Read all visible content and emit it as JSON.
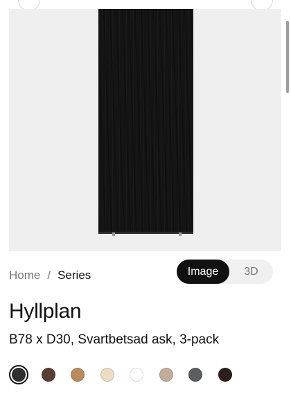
{
  "breadcrumb": {
    "home": "Home",
    "separator": "/",
    "current": "Series"
  },
  "view_toggle": {
    "image_label": "Image",
    "threed_label": "3D",
    "active": "Image"
  },
  "product": {
    "title": "Hyllplan",
    "subtitle": "B78 x D30, Svartbetsad ask, 3-pack"
  },
  "swatches": {
    "selected_index": 0,
    "colors": [
      "#2f3030",
      "#5a3e33",
      "#b98b5e",
      "#ecdcc4",
      "#ffffff",
      "#c2ad9a",
      "#5c5e60",
      "#2a1f1b"
    ]
  },
  "colors": {
    "stage_background": "#efefef",
    "shelf": "#141414",
    "active_toggle": "#111111"
  }
}
